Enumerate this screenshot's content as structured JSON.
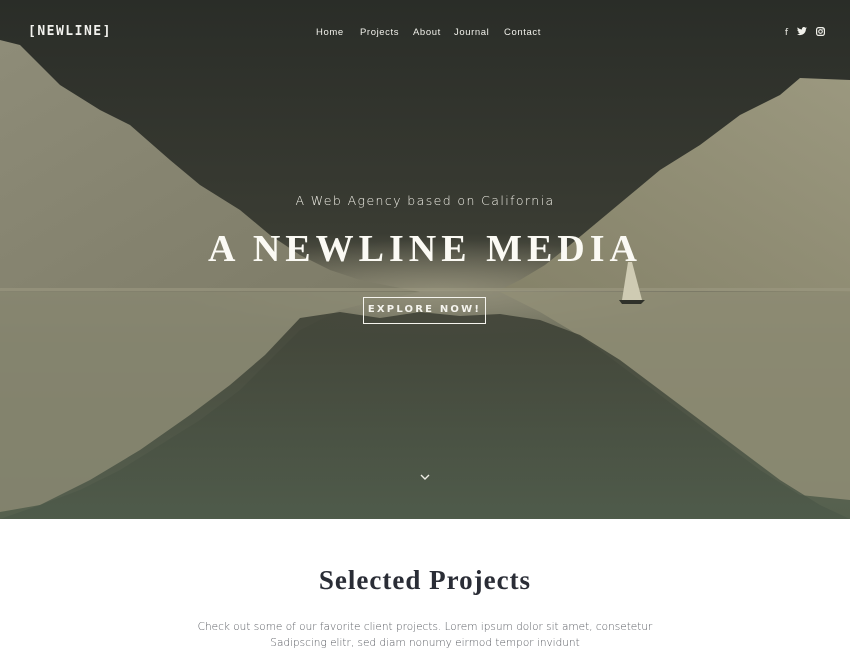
{
  "header": {
    "logo": "[NEWLINE]",
    "nav": [
      {
        "label": "Home"
      },
      {
        "label": "Projects"
      },
      {
        "label": "About"
      },
      {
        "label": "Journal"
      },
      {
        "label": "Contact"
      }
    ],
    "social_icons": [
      "facebook-icon",
      "twitter-icon",
      "instagram-icon"
    ]
  },
  "hero": {
    "subtitle": "A Web Agency based on California",
    "headline": "A NEWLINE MEDIA",
    "cta_label": "EXPLORE NOW!",
    "scroll_icon": "chevron-down-icon"
  },
  "projects": {
    "title": "Selected Projects",
    "description_line1": "Check out some of our favorite client projects. Lorem ipsum dolor sit amet, consetetur",
    "description_line2": "Sadipscing elitr, sed diam nonumy eirmod tempor invidunt"
  },
  "colors": {
    "hero_dark": "#2b2f29",
    "mountain": "#8f8c77",
    "water": "#5f6a55",
    "text_dark": "#2a2d36"
  }
}
